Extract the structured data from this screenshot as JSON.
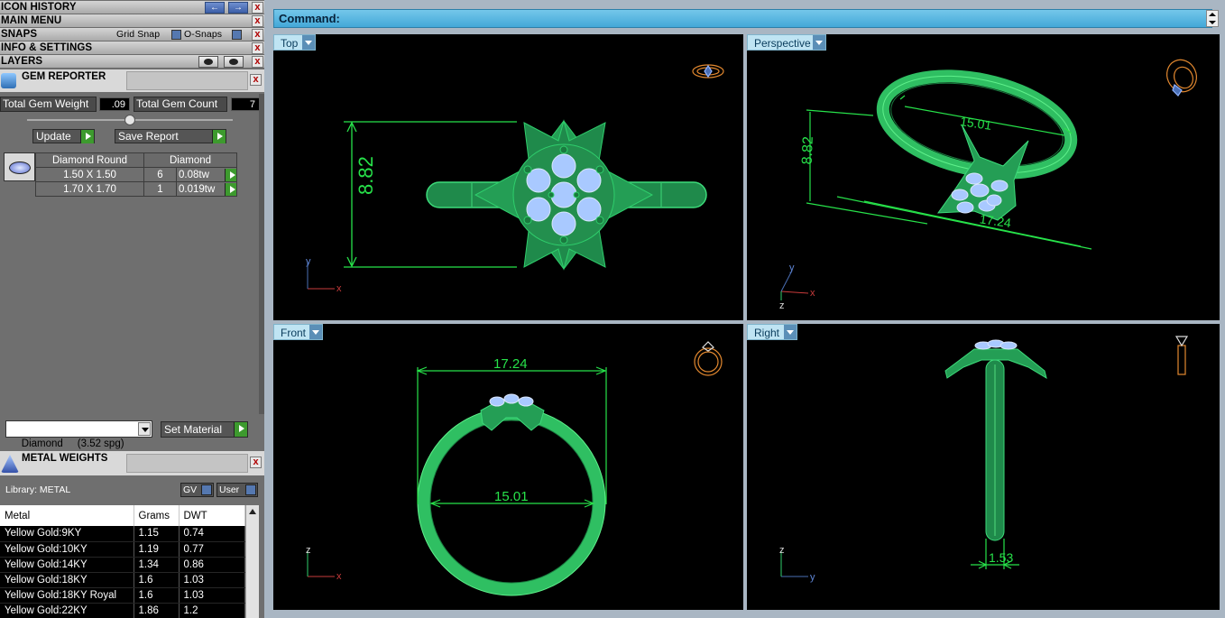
{
  "menus": {
    "icon_history": "ICON HISTORY",
    "main_menu": "MAIN MENU",
    "snaps": "SNAPS",
    "grid_snap": "Grid Snap",
    "o_snaps": "O-Snaps",
    "info_settings": "INFO & SETTINGS",
    "layers": "LAYERS",
    "close": "x"
  },
  "gem_reporter": {
    "title": "GEM REPORTER",
    "total_weight_label": "Total Gem Weight",
    "total_weight_value": ".09",
    "total_count_label": "Total Gem Count",
    "total_count_value": "7",
    "update_label": "Update",
    "save_label": "Save Report",
    "shape_header": "Diamond Round",
    "material_header": "Diamond",
    "rows": [
      {
        "size": "1.50 X 1.50",
        "count": "6",
        "weight": "0.08tw"
      },
      {
        "size": "1.70 X 1.70",
        "count": "1",
        "weight": "0.019tw"
      }
    ],
    "material_select": "Diamond     (3.52 spg)",
    "set_material_label": "Set Material"
  },
  "metal_weights": {
    "title": "METAL WEIGHTS",
    "library_label": "Library: METAL",
    "gv_label": "GV",
    "user_label": "User",
    "columns": [
      "Metal",
      "Grams",
      "DWT"
    ],
    "rows": [
      {
        "metal": "Yellow Gold:9KY",
        "grams": "1.15",
        "dwt": "0.74"
      },
      {
        "metal": "Yellow Gold:10KY",
        "grams": "1.19",
        "dwt": "0.77"
      },
      {
        "metal": "Yellow Gold:14KY",
        "grams": "1.34",
        "dwt": "0.86"
      },
      {
        "metal": "Yellow Gold:18KY",
        "grams": "1.6",
        "dwt": "1.03"
      },
      {
        "metal": "Yellow Gold:18KY Royal",
        "grams": "1.6",
        "dwt": "1.03"
      },
      {
        "metal": "Yellow Gold:22KY",
        "grams": "1.86",
        "dwt": "1.2"
      }
    ]
  },
  "command": {
    "label": "Command:"
  },
  "viewports": {
    "top": {
      "label": "Top",
      "dimension": "8.82",
      "axis_x": "x",
      "axis_y": "y"
    },
    "perspective": {
      "label": "Perspective",
      "dim_width": "15.01",
      "dim_height": "8.82",
      "dim_bottom": "17.24",
      "axis_x": "x",
      "axis_y": "y",
      "axis_z": "z"
    },
    "front": {
      "label": "Front",
      "dim_outer": "17.24",
      "dim_inner": "15.01",
      "axis_x": "x",
      "axis_z": "z"
    },
    "right": {
      "label": "Right",
      "dim_band": "1.53",
      "axis_y": "y",
      "axis_z": "z"
    }
  },
  "colors": {
    "model_green": "#2eb866",
    "dimension_green": "#27e24a",
    "gem_blue": "#a9c9ff",
    "command_bar": "#4ab0de",
    "viewport_bg": "#000000"
  },
  "icons": [
    "back-arrow-icon",
    "forward-arrow-icon",
    "eye-icon",
    "close-icon",
    "gem-reporter-icon",
    "diamond-icon",
    "metal-weights-icon",
    "dropdown-arrow-icon",
    "ring-orientation-icon"
  ]
}
